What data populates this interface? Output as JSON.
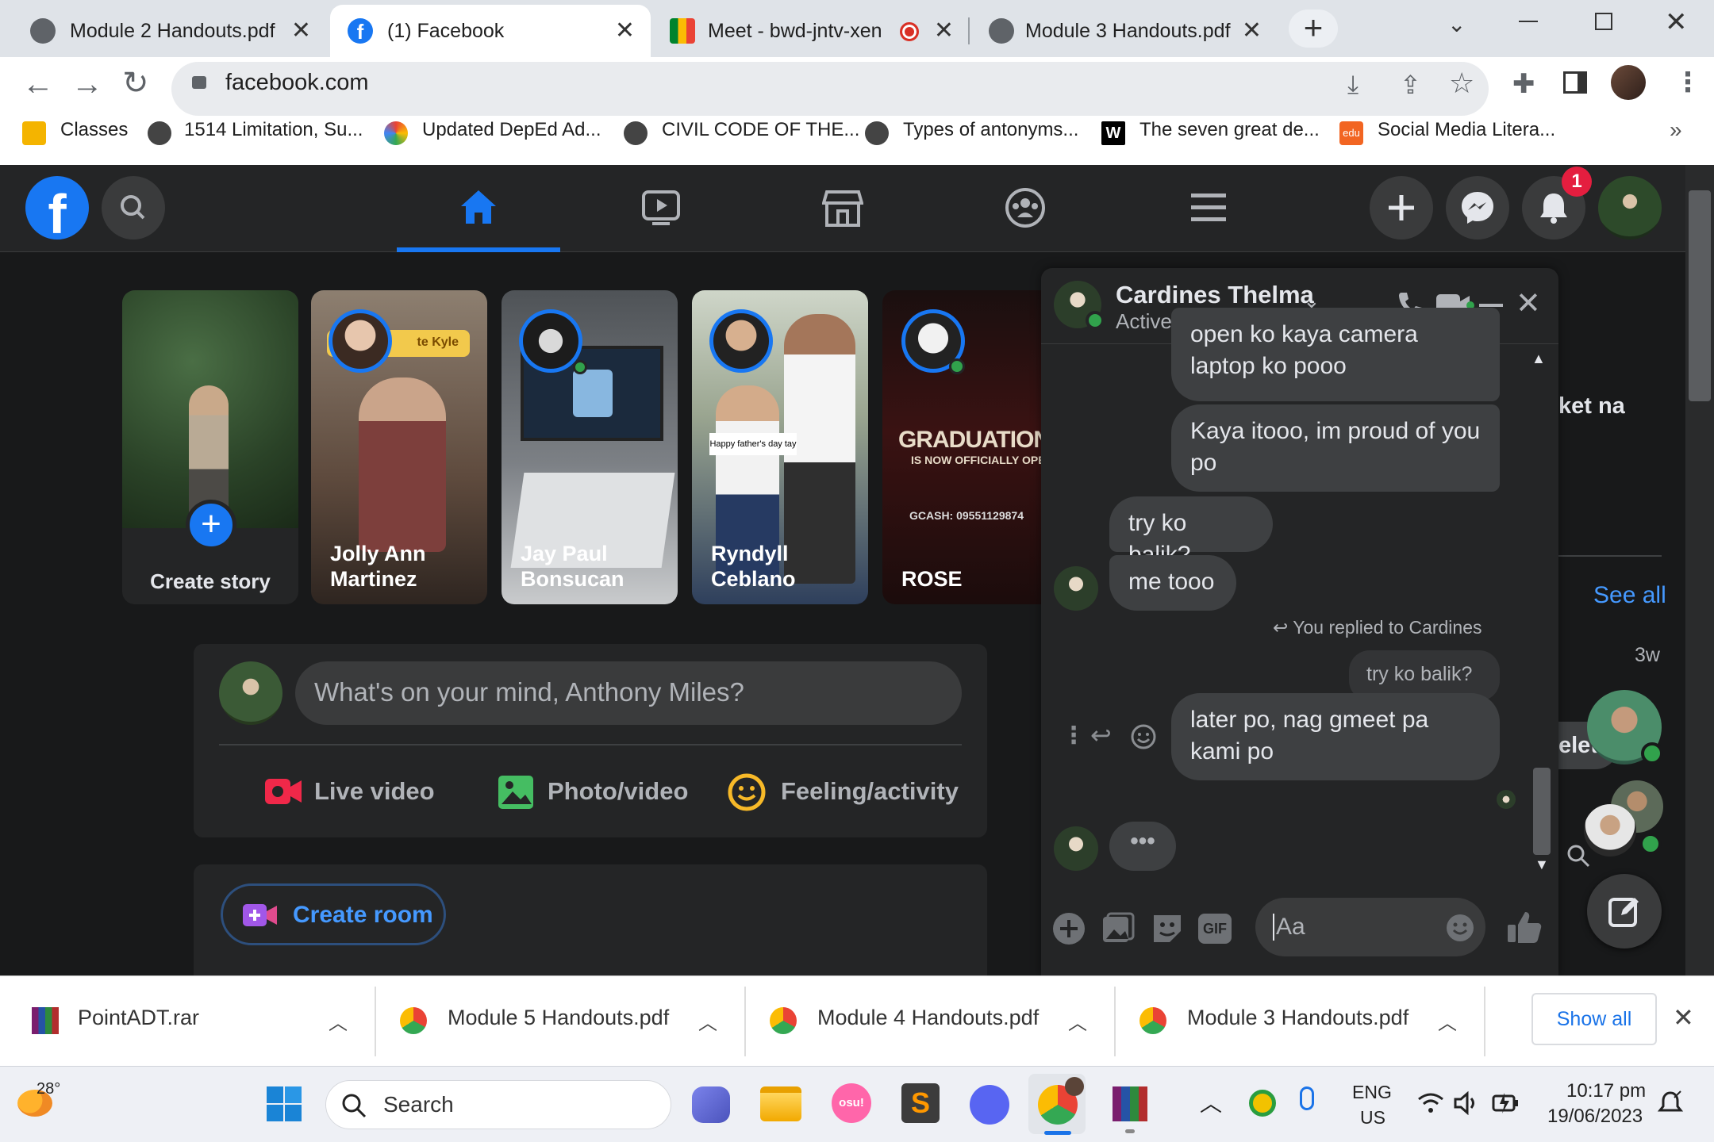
{
  "tabs": [
    {
      "label": "Module 2 Handouts.pdf",
      "active": false
    },
    {
      "label": "(1) Facebook",
      "active": true
    },
    {
      "label": "Meet - bwd-jntv-xen",
      "active": false
    },
    {
      "label": "Module 3 Handouts.pdf",
      "active": false
    }
  ],
  "address_bar": {
    "url": "facebook.com"
  },
  "bookmarks": [
    "Classes",
    "1514 Limitation, Su...",
    "Updated DepEd Ad...",
    "CIVIL CODE OF THE...",
    "Types of antonyms...",
    "The seven great de...",
    "Social Media Litera..."
  ],
  "bookmark_icon_letters": {
    "w": "W",
    "edu": "edu"
  },
  "fb": {
    "notification_count": "1",
    "stories": [
      {
        "name": "Create story"
      },
      {
        "name": "Jolly Ann Martinez",
        "overlay_text": "te Kyle"
      },
      {
        "name": "Jay Paul Bonsucan"
      },
      {
        "name": "Ryndyll Ceblano",
        "overlay_text": "Happy father's day tay"
      },
      {
        "name": "ROSE",
        "banner": "GRADUATION GIF",
        "banner_sub": "IS NOW OFFICIALLY OPEN",
        "gcash": "GCASH: 09551129874"
      }
    ],
    "composer_placeholder": "What's on your mind, Anthony Miles?",
    "composer_actions": [
      "Live video",
      "Photo/video",
      "Feeling/activity"
    ],
    "create_room": "Create room",
    "right_panel": {
      "partial_text": "ket na",
      "see_all": "See all",
      "time": "3w",
      "partial_delete": "elet"
    }
  },
  "chat": {
    "contact_name": "Cardines Thelma",
    "status": "Active now",
    "messages": [
      {
        "text": "open ko kaya camera laptop ko pooo",
        "side": "right"
      },
      {
        "text": "Kaya itooo, im proud of you po",
        "side": "right"
      },
      {
        "text": "try ko balik?",
        "side": "left"
      },
      {
        "text": "me tooo",
        "side": "left"
      }
    ],
    "reply_note": "You replied to Cardines",
    "quoted_text": "try ko balik?",
    "last_message": "later po, nag gmeet pa kami po",
    "input_placeholder": "Aa",
    "gif_label": "GIF"
  },
  "downloads": [
    "PointADT.rar",
    "Module 5 Handouts.pdf",
    "Module 4 Handouts.pdf",
    "Module 3 Handouts.pdf"
  ],
  "show_all": "Show all",
  "taskbar": {
    "weather": "28°",
    "search_label": "Search",
    "osu_label": "osu!",
    "language": "ENG",
    "region": "US",
    "time": "10:17 pm",
    "date": "19/06/2023"
  },
  "colors": {
    "fb_blue": "#1877f2",
    "fb_bg": "#18191a",
    "fb_card": "#242526",
    "bubble": "#3e4042",
    "online_green": "#31a24c",
    "notif_red": "#e41e3f"
  }
}
